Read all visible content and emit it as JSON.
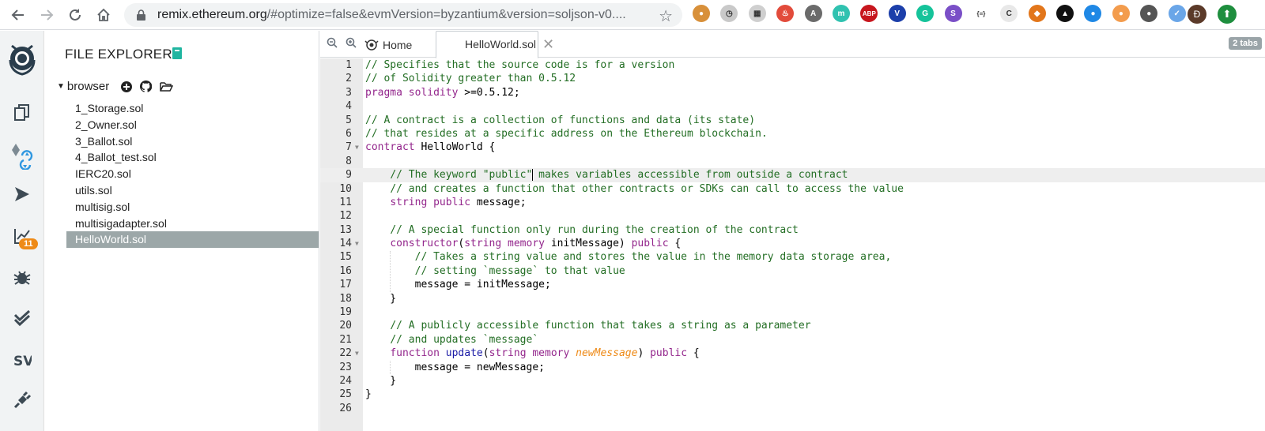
{
  "browser": {
    "url_host": "remix.ethereum.org",
    "url_rest": "/#optimize=false&evmVersion=byzantium&version=soljson-v0....",
    "profile_initial": "Đ",
    "extensions": [
      {
        "name": "cookie-extension-icon",
        "color": "#d8903a",
        "glyph": "●"
      },
      {
        "name": "clock-extension-icon",
        "color": "#c9c9c9",
        "glyph": "◷"
      },
      {
        "name": "grid-extension-icon",
        "color": "#cfcfcf",
        "glyph": "▦"
      },
      {
        "name": "fire-extension-icon",
        "color": "#e24b3b",
        "glyph": "♨"
      },
      {
        "name": "a-extension-icon",
        "color": "#6b6b6b",
        "glyph": "A"
      },
      {
        "name": "m-extension-icon",
        "color": "#30c2b0",
        "glyph": "m"
      },
      {
        "name": "abp-extension-icon",
        "color": "#c7161e",
        "glyph": "ABP"
      },
      {
        "name": "v-extension-icon",
        "color": "#1c3faa",
        "glyph": "V"
      },
      {
        "name": "grammarly-extension-icon",
        "color": "#15c39a",
        "glyph": "G"
      },
      {
        "name": "s-extension-icon",
        "color": "#7a4fc7",
        "glyph": "S"
      },
      {
        "name": "json-extension-icon",
        "color": "#ffffff",
        "glyph": "{≡}"
      },
      {
        "name": "c-extension-icon",
        "color": "#e8e8e8",
        "glyph": "C"
      },
      {
        "name": "metamask-extension-icon",
        "color": "#e2761b",
        "glyph": "◆"
      },
      {
        "name": "bird-extension-icon",
        "color": "#111111",
        "glyph": "▲"
      },
      {
        "name": "drop-extension-icon",
        "color": "#1f88e5",
        "glyph": "●"
      },
      {
        "name": "flask-extension-icon",
        "color": "#f39c4d",
        "glyph": "●"
      },
      {
        "name": "github-extension-icon",
        "color": "#555555",
        "glyph": "●"
      },
      {
        "name": "check-extension-icon",
        "color": "#6aa6e8",
        "glyph": "✓"
      }
    ]
  },
  "icon_panel": {
    "analysis_badge": "11"
  },
  "side_panel": {
    "title": "FILE EXPLORERS",
    "root": "browser",
    "files": [
      "1_Storage.sol",
      "2_Owner.sol",
      "3_Ballot.sol",
      "4_Ballot_test.sol",
      "IERC20.sol",
      "utils.sol",
      "multisig.sol",
      "multisigadapter.sol",
      "HelloWorld.sol"
    ],
    "active_index": 8
  },
  "editor": {
    "home_tab": "Home",
    "file_tab": "HelloWorld.sol",
    "tabs_count": "2 tabs",
    "current_line": 9,
    "lines": [
      {
        "n": "1",
        "fold": false,
        "tokens": [
          [
            "cm",
            "// Specifies that the source code is for a version"
          ]
        ]
      },
      {
        "n": "2",
        "fold": false,
        "tokens": [
          [
            "cm",
            "// of Solidity greater than 0.5.12"
          ]
        ]
      },
      {
        "n": "3",
        "fold": false,
        "tokens": [
          [
            "kw",
            "pragma"
          ],
          [
            "",
            " "
          ],
          [
            "kw",
            "solidity"
          ],
          [
            "",
            " >=0.5.12;"
          ]
        ]
      },
      {
        "n": "4",
        "fold": false,
        "tokens": []
      },
      {
        "n": "5",
        "fold": false,
        "tokens": [
          [
            "cm",
            "// A contract is a collection of functions and data (its state)"
          ]
        ]
      },
      {
        "n": "6",
        "fold": false,
        "tokens": [
          [
            "cm",
            "// that resides at a specific address on the Ethereum blockchain."
          ]
        ]
      },
      {
        "n": "7",
        "fold": true,
        "tokens": [
          [
            "kw",
            "contract"
          ],
          [
            "",
            " HelloWorld {"
          ]
        ]
      },
      {
        "n": "8",
        "fold": false,
        "tokens": []
      },
      {
        "n": "9",
        "fold": false,
        "tokens": [
          [
            "",
            "    "
          ],
          [
            "cm",
            "// The keyword \"public\""
          ],
          [
            "cursor",
            ""
          ],
          [
            "cm",
            " makes variables accessible from outside a contract"
          ]
        ]
      },
      {
        "n": "10",
        "fold": false,
        "tokens": [
          [
            "",
            "    "
          ],
          [
            "cm",
            "// and creates a function that other contracts or SDKs can call to access the value"
          ]
        ]
      },
      {
        "n": "11",
        "fold": false,
        "tokens": [
          [
            "",
            "    "
          ],
          [
            "kw",
            "string"
          ],
          [
            "",
            " "
          ],
          [
            "kw",
            "public"
          ],
          [
            "",
            " message;"
          ]
        ]
      },
      {
        "n": "12",
        "fold": false,
        "tokens": []
      },
      {
        "n": "13",
        "fold": false,
        "tokens": [
          [
            "",
            "    "
          ],
          [
            "cm",
            "// A special function only run during the creation of the contract"
          ]
        ]
      },
      {
        "n": "14",
        "fold": true,
        "tokens": [
          [
            "",
            "    "
          ],
          [
            "kw",
            "constructor"
          ],
          [
            "",
            "("
          ],
          [
            "kw",
            "string"
          ],
          [
            "",
            " "
          ],
          [
            "kw",
            "memory"
          ],
          [
            "",
            " initMessage) "
          ],
          [
            "kw",
            "public"
          ],
          [
            "",
            " {"
          ]
        ]
      },
      {
        "n": "15",
        "fold": false,
        "tokens": [
          [
            "",
            "        "
          ],
          [
            "cm",
            "// Takes a string value and stores the value in the memory data storage area,"
          ]
        ]
      },
      {
        "n": "16",
        "fold": false,
        "tokens": [
          [
            "",
            "        "
          ],
          [
            "cm",
            "// setting `message` to that value"
          ]
        ]
      },
      {
        "n": "17",
        "fold": false,
        "tokens": [
          [
            "",
            "        message = initMessage;"
          ]
        ]
      },
      {
        "n": "18",
        "fold": false,
        "tokens": [
          [
            "",
            "    }"
          ]
        ]
      },
      {
        "n": "19",
        "fold": false,
        "tokens": []
      },
      {
        "n": "20",
        "fold": false,
        "tokens": [
          [
            "",
            "    "
          ],
          [
            "cm",
            "// A publicly accessible function that takes a string as a parameter"
          ]
        ]
      },
      {
        "n": "21",
        "fold": false,
        "tokens": [
          [
            "",
            "    "
          ],
          [
            "cm",
            "// and updates `message`"
          ]
        ]
      },
      {
        "n": "22",
        "fold": true,
        "tokens": [
          [
            "",
            "    "
          ],
          [
            "kw",
            "function"
          ],
          [
            "",
            " "
          ],
          [
            "fn",
            "update"
          ],
          [
            "",
            "("
          ],
          [
            "kw",
            "string"
          ],
          [
            "",
            " "
          ],
          [
            "kw",
            "memory"
          ],
          [
            "",
            " "
          ],
          [
            "pm",
            "newMessage"
          ],
          [
            "",
            ") "
          ],
          [
            "kw",
            "public"
          ],
          [
            "",
            " {"
          ]
        ]
      },
      {
        "n": "23",
        "fold": false,
        "tokens": [
          [
            "",
            "        message = newMessage;"
          ]
        ]
      },
      {
        "n": "24",
        "fold": false,
        "tokens": [
          [
            "",
            "    }"
          ]
        ]
      },
      {
        "n": "25",
        "fold": false,
        "tokens": [
          [
            "",
            "}"
          ]
        ]
      },
      {
        "n": "26",
        "fold": false,
        "tokens": []
      }
    ]
  }
}
